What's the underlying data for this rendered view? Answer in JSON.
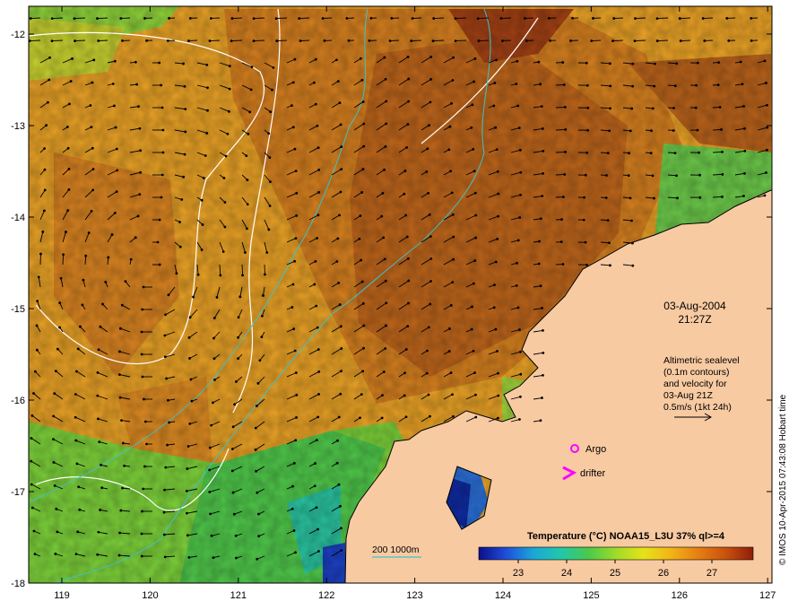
{
  "map": {
    "date": "03-Aug-2004",
    "time": "21:27Z",
    "altimetry_note": [
      "Altimetric sealevel",
      "(0.1m contours)",
      "and velocity for",
      "03-Aug 21Z",
      "0.5m/s (1kt 24h)"
    ],
    "legend": {
      "argo_label": "Argo",
      "drifter_label": "drifter",
      "bathymetry_label": "200  1000m"
    },
    "colorbar": {
      "title": "Temperature (°C) NOAA15_L3U 37% ql>=4",
      "ticks": [
        "23",
        "24",
        "25",
        "26",
        "27"
      ],
      "colors": [
        "#0b0f8a",
        "#1f4fd8",
        "#1aa8d8",
        "#22c7a8",
        "#4ac94a",
        "#9fdb2a",
        "#e6e21a",
        "#f2b418",
        "#e67e12",
        "#c9520e",
        "#8f1d0a"
      ]
    },
    "axes": {
      "lat_ticks": [
        "-12",
        "-13",
        "-14",
        "-15",
        "-16",
        "-17",
        "-18"
      ],
      "lon_ticks": [
        "119",
        "120",
        "121",
        "122",
        "123",
        "124",
        "125",
        "126",
        "127"
      ]
    },
    "credit": "© IMOS 10-Apr-2015 07:43:08 Hobart time",
    "colors": {
      "land": "#f8caa2",
      "warm_sea": "#dd8a22",
      "hot_sea": "#b9601a",
      "mid_sea": "#f0b52a",
      "cool_sea": "#86d23a",
      "cold_sea": "#2a6fd6",
      "contour": "#ffffff",
      "bathymetry": "#3fc2c8",
      "marker": "#ff00ff"
    }
  }
}
